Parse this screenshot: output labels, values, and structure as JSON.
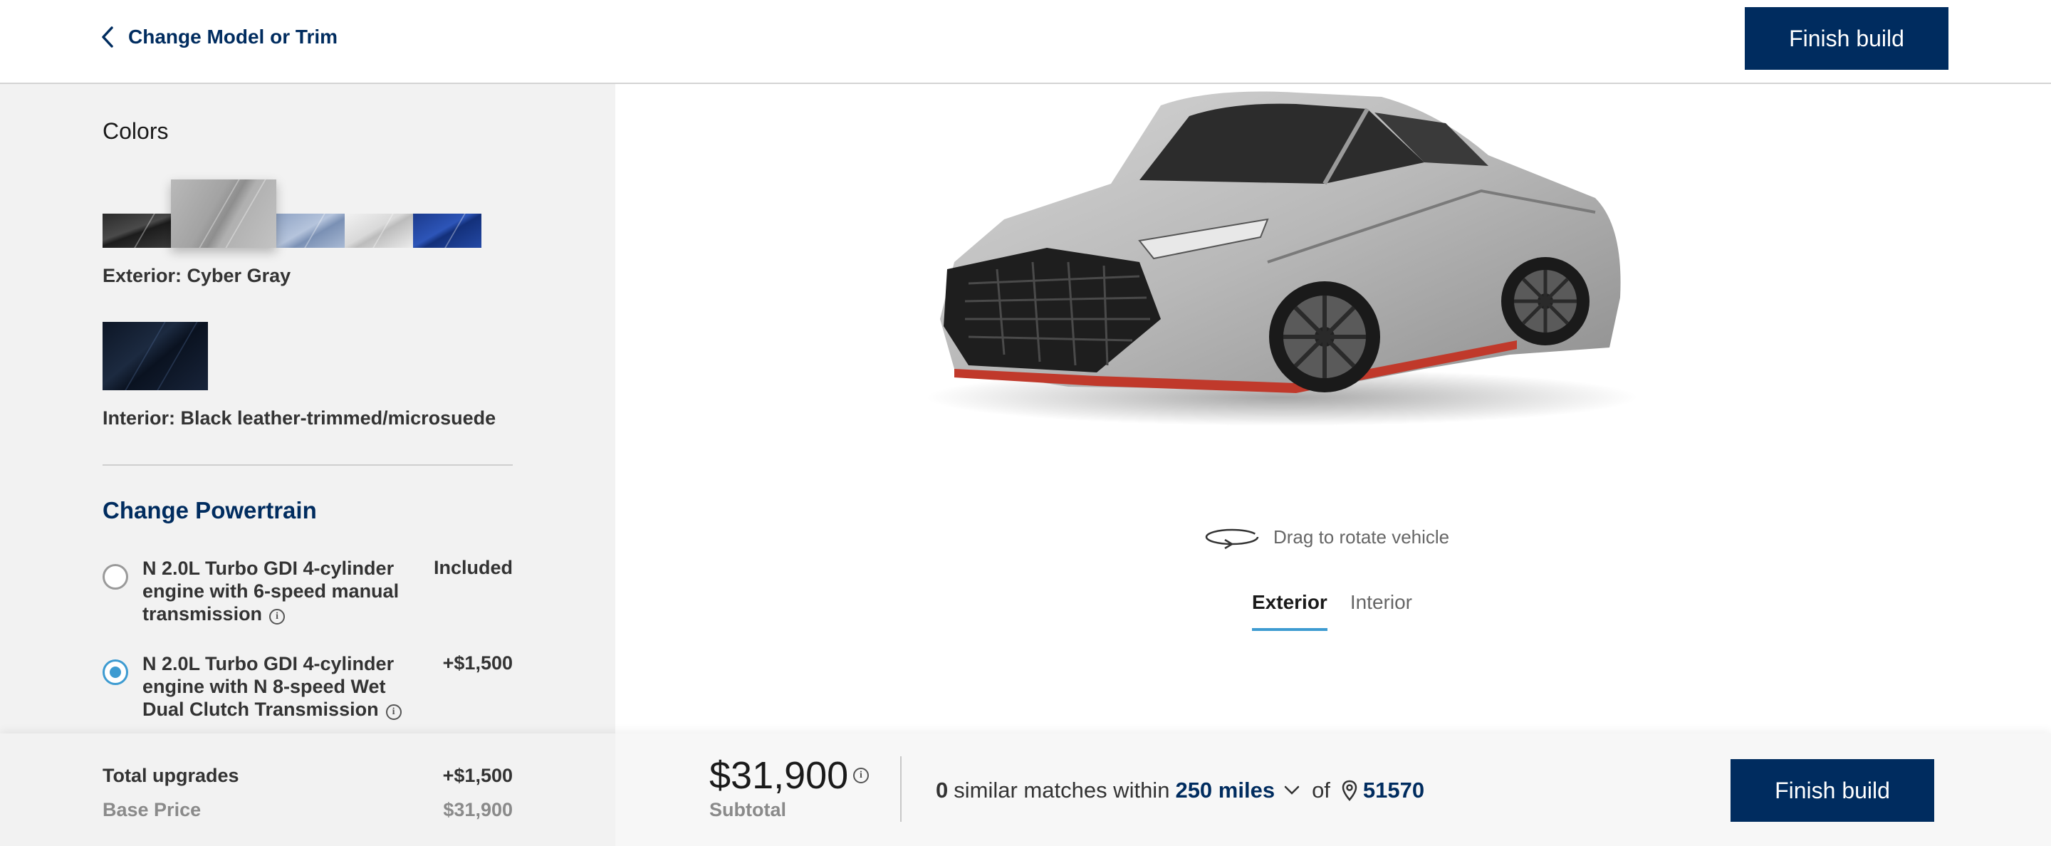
{
  "header": {
    "back_label": "Change Model or Trim",
    "finish_label": "Finish build"
  },
  "colors": {
    "title": "Colors",
    "exterior_label": "Exterior: Cyber Gray",
    "interior_label": "Interior: Black leather-trimmed/microsuede",
    "exterior_swatches": [
      {
        "name": "black",
        "color": "#2a2a2a"
      },
      {
        "name": "cyber-gray",
        "color": "#a3a3a3",
        "selected": true
      },
      {
        "name": "light-blue",
        "color": "#a8b9d4"
      },
      {
        "name": "white",
        "color": "#e6e6e6"
      },
      {
        "name": "blue",
        "color": "#2449a5"
      }
    ],
    "interior_swatch": {
      "name": "black",
      "color": "#0d1626"
    }
  },
  "powertrain": {
    "title": "Change Powertrain",
    "options": [
      {
        "label": "N 2.0L Turbo GDI 4-cylinder engine with 6-speed manual transmission",
        "price": "Included",
        "selected": false
      },
      {
        "label": "N 2.0L Turbo GDI 4-cylinder engine with N 8-speed Wet Dual Clutch Transmission",
        "price": "+$1,500",
        "selected": true
      }
    ]
  },
  "viewer": {
    "rotate_hint": "Drag to rotate vehicle",
    "tabs": [
      {
        "label": "Exterior",
        "active": true
      },
      {
        "label": "Interior",
        "active": false
      }
    ]
  },
  "summary": {
    "total_upgrades_label": "Total upgrades",
    "total_upgrades_value": "+$1,500",
    "base_price_label": "Base Price",
    "base_price_value": "$31,900",
    "subtotal_value": "$31,900",
    "subtotal_label": "Subtotal"
  },
  "inventory": {
    "count": "0",
    "text": "similar matches within",
    "radius": "250 miles",
    "of_label": "of",
    "zip": "51570"
  },
  "theme": {
    "brand_navy": "#002c5f",
    "accent_blue": "#3d9bd1"
  }
}
